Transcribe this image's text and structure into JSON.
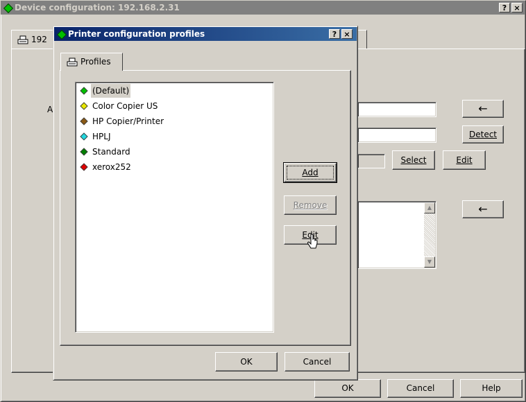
{
  "device_window": {
    "title": "Device configuration: 192.168.2.31",
    "help_btn": "?",
    "close_btn": "×",
    "tab_label": "192",
    "left_label": "A",
    "arrow_button_1": "←",
    "detect_button": "Detect",
    "select_button": "Select",
    "edit_button": "Edit",
    "arrow_button_2": "←",
    "ok_button": "OK",
    "cancel_button": "Cancel",
    "help_button": "Help"
  },
  "profiles_dialog": {
    "title": "Printer configuration profiles",
    "help_btn": "?",
    "close_btn": "×",
    "tab_label": "Profiles",
    "profiles": [
      {
        "label": "(Default)",
        "color": "#00c000",
        "selected": true
      },
      {
        "label": "Color Copier US",
        "color": "#e8e800",
        "selected": false
      },
      {
        "label": "HP Copier/Printer",
        "color": "#8b5a14",
        "selected": false
      },
      {
        "label": "HPLJ",
        "color": "#20d8e0",
        "selected": false
      },
      {
        "label": "Standard",
        "color": "#008000",
        "selected": false
      },
      {
        "label": "xerox252",
        "color": "#e00000",
        "selected": false
      }
    ],
    "add_button": "Add",
    "remove_button": "Remove",
    "edit_button": "Edit",
    "ok_button": "OK",
    "cancel_button": "Cancel"
  }
}
